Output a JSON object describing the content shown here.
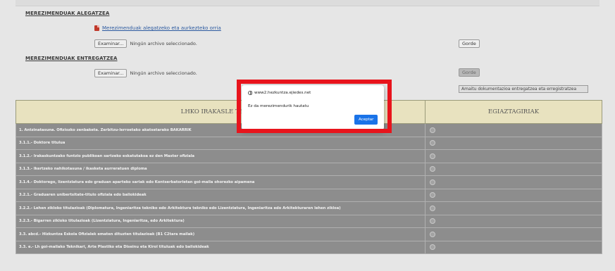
{
  "sections": {
    "allegation_title": "MEREZIMENDUAK ALEGATZEA",
    "allegation_link": "Merezimenduak alegatzeko eta aurkezteko orria",
    "delivery_title": "MEREZIMENDUAK ENTREGATZEA"
  },
  "file_inputs": [
    {
      "browse_label": "Examinar...",
      "status": "Ningún archivo seleccionado.",
      "save_label": "Gorde"
    },
    {
      "browse_label": "Examinar...",
      "status": "Ningún archivo seleccionado.",
      "save_label": "Gorde"
    }
  ],
  "register_button": "Amaitu dokumentazioa entregatzea eta erregistratzea",
  "table": {
    "headers": [
      "LHKO IRAKASLE TEKNIK",
      "EGIAZTAGIRIAK"
    ],
    "rows": [
      "1. Antzinatasuna. Ofiziozko zenbaketa. Zerbitzu-lerroetako akatsetarako BAKARRIK",
      "3.1.1.- Doktore titulua",
      "3.1.2.- Irakaskuntzako funtzio publikoan sartzeko eskatutakoa ez den Master ofiziala",
      "3.1.3.- Ikertzeko nahikotasuna / ikasketa aurreratuen diploma",
      "3.1.4.- Doktorego, lizentziatura edo graduan aparteko sariak edo Kontserbatorietan goi-maila ohorezko aipamena",
      "3.2.1.- Graduaren unibertsitate-titulo ofiziala edo baliokideak",
      "3.2.2.- Lehen zikloko titulazioak (Diplomatura, Ingeniaritza tekniko edo Arkitektura tekniko edo Lizentziatura, Ingeniaritza edo Arkitekturaren lehen zikloa)",
      "3.2.3.- Bigarren zikloko titulazioak (Lizentziatura, Ingeniaritza, edo Arkitektura)",
      "3.3. abcd.- Hizkuntza Eskola Ofizialek ematen dituzten titulazioak (B1 C2tara mailak)",
      "3.3. e.- Lh goi-mailako Teknikari, Arte Plastiko eta Diseinu eta Kirol tituluak edo baliokideak"
    ]
  },
  "dialog": {
    "site": "www2.hezkuntza.ejiedes.net",
    "message": "Ez da merezimendurik hautatu",
    "ok_label": "Aceptar"
  },
  "colors": {
    "highlight": "#e8141c",
    "table_header": "#e8e2bf",
    "table_row": "#8d8d8d",
    "ok_button": "#1a73e8"
  }
}
